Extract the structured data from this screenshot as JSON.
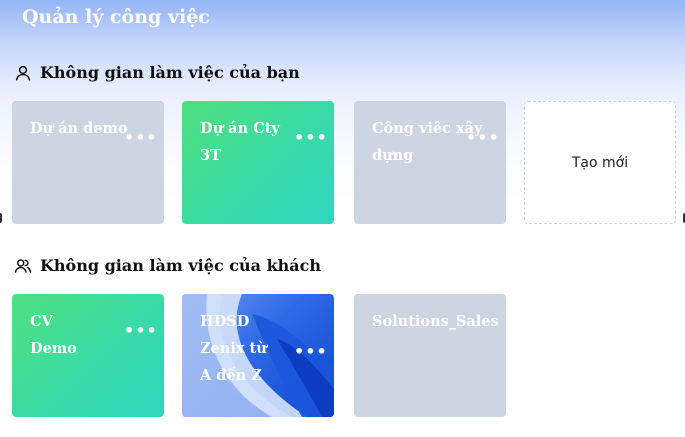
{
  "header": {
    "title": "Quản lý công việc"
  },
  "own_workspaces": {
    "title": "Không gian làm việc của bạn",
    "icon": "user-icon",
    "cards": [
      {
        "name": "Dự án demo",
        "style": "gray",
        "more": "•••"
      },
      {
        "name": "Dự án Cty 3T",
        "style": "green",
        "more": "•••"
      },
      {
        "name": "Công viêc xây dựng",
        "style": "gray",
        "more": "•••"
      }
    ],
    "create_label": "Tạo mới"
  },
  "guest_workspaces": {
    "title": "Không gian làm việc của khách",
    "icon": "users-icon",
    "cards": [
      {
        "name": "CV Demo",
        "style": "green",
        "more": "•••"
      },
      {
        "name": "HDSD Zenix từ A đến Z",
        "style": "image",
        "more": "•••"
      },
      {
        "name": "Solutions_Sales",
        "style": "gray"
      }
    ]
  },
  "colors": {
    "gray_card": "#ccd5e1",
    "green_start": "#4fdf7d",
    "green_end": "#2fd6c0",
    "image_blue": "#2f6ae6"
  }
}
